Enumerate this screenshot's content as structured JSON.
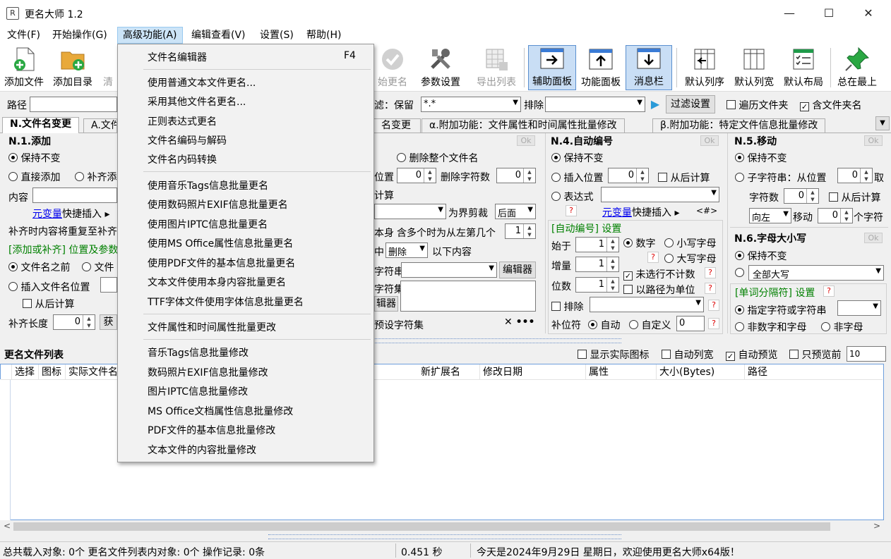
{
  "window": {
    "title": "更名大师 1.2",
    "minimize": "—",
    "maximize": "☐",
    "close": "✕"
  },
  "menubar": [
    "文件(F)",
    "开始操作(G)",
    "高级功能(A)",
    "编辑查看(V)",
    "设置(S)",
    "帮助(H)"
  ],
  "toolbar": {
    "add_file": "添加文件",
    "add_dir": "添加目录",
    "clear_partial": "清",
    "start_rename": "始更名",
    "param_settings": "参数设置",
    "export_list": "导出列表",
    "assist_panel": "辅助面板",
    "function_panel": "功能面板",
    "message_bar": "消息栏",
    "default_order": "默认列序",
    "default_width": "默认列宽",
    "default_layout": "默认布局",
    "always_top": "总在最上"
  },
  "pathbar": {
    "path_label": "路径",
    "filter_label": "滤：保留",
    "filter_value": "*.*",
    "exclude_label": "排除",
    "filter_settings": "过滤设置",
    "traverse_folders": "遍历文件夹",
    "include_folder_name": "含文件夹名"
  },
  "tabs": [
    "N.文件名变更",
    "A.文件",
    "名变更",
    "α.附加功能：文件属性和时间属性批量修改",
    "β.附加功能：特定文件信息批量修改"
  ],
  "panel_add": {
    "title": "N.1.添加",
    "ok": "Ok",
    "keep": "保持不变",
    "direct_add": "直接添加",
    "pad_add": "补齐添",
    "content_label": "内容",
    "var_link": "元变量",
    "quick_insert": "快捷插入",
    "repeat_text": "补齐时内容将重复至补齐",
    "section": "[添加或补齐] 位置及参数",
    "before_name": "文件名之前",
    "file_partial": "文件",
    "insert_pos": "插入文件名位置",
    "from_back": "从后计算",
    "pad_length_label": "补齐长度",
    "pad_length_value": "0",
    "get_partial": "获取"
  },
  "panel_delete": {
    "delete_whole": "删除整个文件名",
    "pos_label": "位置",
    "pos_value": "0",
    "del_count_label": "删除字符数",
    "del_count_value": "0",
    "calc": "计算",
    "boundary_trim": "为界剪裁",
    "back": "后面",
    "self": "本身",
    "multi": "含多个时为从左第几个",
    "multi_value": "1",
    "middle": "中",
    "delete_opt": "删除",
    "below": "以下内容",
    "char_string": "字符串",
    "editor": "编辑器",
    "char_set": "字符集",
    "editor2": "辑器",
    "preset": "预设字符集"
  },
  "panel_number": {
    "title": "N.4.自动编号",
    "ok": "Ok",
    "keep": "保持不变",
    "insert_pos": "插入位置",
    "insert_value": "0",
    "from_back": "从后计算",
    "expression": "表达式",
    "help": "?",
    "var_link": "元变量",
    "quick_insert": "快捷插入",
    "hash": "<#>",
    "section": "[自动编号] 设置",
    "start_label": "始于",
    "start_value": "1",
    "digit": "数字",
    "lower_letter": "小写字母",
    "upper_letter": "大写字母",
    "step_label": "增量",
    "step_value": "1",
    "unselected": "未选行不计数",
    "digits_label": "位数",
    "digits_value": "1",
    "by_path": "以路径为单位",
    "exclude": "排除",
    "pad_char": "补位符",
    "auto": "自动",
    "custom": "自定义",
    "custom_value": "0"
  },
  "panel_move": {
    "title": "N.5.移动",
    "ok": "Ok",
    "keep": "保持不变",
    "substring": "子字符串：从位置",
    "sub_value": "0",
    "take": "取",
    "char_count": "字符数",
    "char_count_value": "0",
    "from_back": "从后计算",
    "direction": "向左",
    "move": "移动",
    "move_value": "0",
    "chars": "个字符"
  },
  "panel_case": {
    "title": "N.6.字母大小写",
    "ok": "Ok",
    "keep": "保持不变",
    "all_upper": "全部大写",
    "section": "[单词分隔符] 设置",
    "help": "?",
    "specified": "指定字符或字符串",
    "non_alnum": "非数字和字母",
    "non_letter": "非字母"
  },
  "list_section": {
    "title": "更名文件列表",
    "show_icons": "显示实际图标",
    "auto_width": "自动列宽",
    "auto_preview": "自动预览",
    "preview_only": "只预览前",
    "preview_count": "10",
    "columns": [
      "选择",
      "图标",
      "实际文件名",
      "新扩展名",
      "修改日期",
      "属性",
      "大小(Bytes)",
      "路径"
    ]
  },
  "statusbar": {
    "left": "总共载入对象: 0个  更名文件列表内对象: 0个  操作记录: 0条",
    "time": "0.451 秒",
    "message": "今天是2024年9月29日 星期日，欢迎使用更名大师x64版！"
  },
  "dropdown": {
    "items": [
      {
        "label": "文件名编辑器",
        "shortcut": "F4"
      },
      {
        "label": "使用普通文本文件更名..."
      },
      {
        "label": "采用其他文件名更名..."
      },
      {
        "label": "正则表达式更名"
      },
      {
        "label": "文件名编码与解码"
      },
      {
        "label": "文件名内码转换"
      },
      {
        "label": "使用音乐Tags信息批量更名"
      },
      {
        "label": "使用数码照片EXIF信息批量更名"
      },
      {
        "label": "使用图片IPTC信息批量更名"
      },
      {
        "label": "使用MS Office属性信息批量更名"
      },
      {
        "label": "使用PDF文件的基本信息批量更名"
      },
      {
        "label": "文本文件使用本身内容批量更名"
      },
      {
        "label": "TTF字体文件使用字体信息批量更名"
      },
      {
        "label": "文件属性和时间属性批量更改"
      },
      {
        "label": "音乐Tags信息批量修改"
      },
      {
        "label": "数码照片EXIF信息批量修改"
      },
      {
        "label": "图片IPTC信息批量修改"
      },
      {
        "label": "MS Office文档属性信息批量修改"
      },
      {
        "label": "PDF文件的基本信息批量修改"
      },
      {
        "label": "文本文件的内容批量修改"
      }
    ]
  }
}
